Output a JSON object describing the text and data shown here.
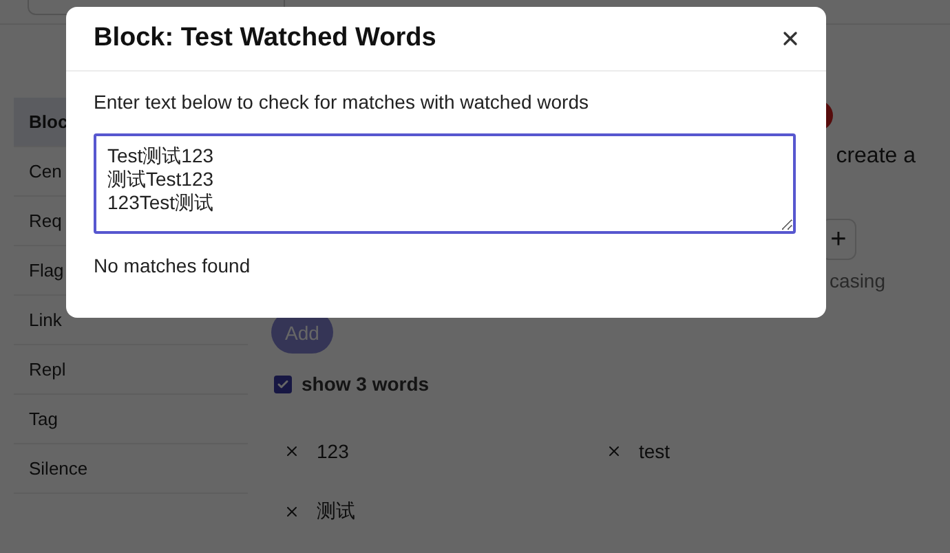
{
  "sidebar": {
    "items": [
      {
        "label": "Bloc",
        "selected": true
      },
      {
        "label": "Cen",
        "selected": false
      },
      {
        "label": "Req",
        "selected": false
      },
      {
        "label": "Flag",
        "selected": false
      },
      {
        "label": "Link",
        "selected": false
      },
      {
        "label": "Repl",
        "selected": false
      },
      {
        "label": "Tag",
        "selected": false
      },
      {
        "label": "Silence",
        "selected": false
      }
    ]
  },
  "main": {
    "intro_fragment": "create a",
    "plus_button": "+",
    "option_fragment": "casing",
    "add_button": {
      "label": "Add",
      "disabled": true
    },
    "show_words": {
      "label": "show 3 words",
      "checked": true
    },
    "words": [
      {
        "label": "123"
      },
      {
        "label": "test"
      },
      {
        "label": "测试"
      }
    ]
  },
  "dialog": {
    "title": "Block: Test Watched Words",
    "description": "Enter text below to check for matches with watched words",
    "textarea": {
      "value": "Test测试123\n测试Test123\n123Test测试"
    },
    "result": "No matches found"
  }
}
